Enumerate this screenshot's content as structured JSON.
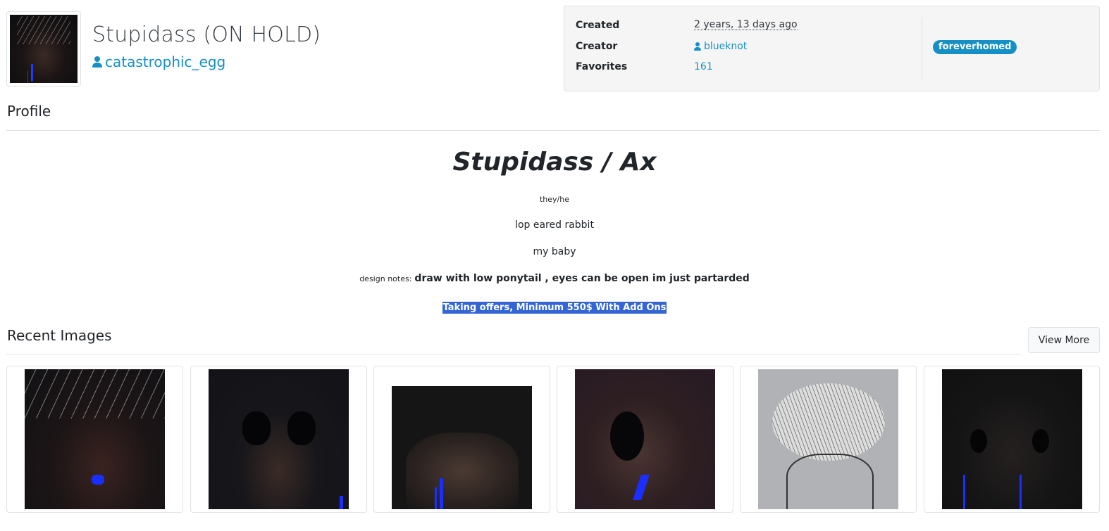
{
  "character": {
    "title": "Stupidass (ON HOLD)",
    "owner": "catastrophic_egg"
  },
  "info": {
    "created_label": "Created",
    "created_value": "2 years, 13 days ago",
    "creator_label": "Creator",
    "creator_value": "blueknot",
    "favorites_label": "Favorites",
    "favorites_value": "161",
    "tag": "foreverhomed"
  },
  "sections": {
    "profile": "Profile",
    "recent_images": "Recent Images",
    "view_more": "View More"
  },
  "profile": {
    "name": "Stupidass / Ax",
    "pronouns": "they/he",
    "species": "lop eared rabbit",
    "note": "my baby",
    "design_notes_label": "design notes:",
    "design_notes": "draw with low ponytail , eyes can be open im just partarded",
    "offer": "Taking offers, Minimum 550$ With Add Ons"
  },
  "colors": {
    "link": "#1590c4",
    "badge": "#1590c4",
    "highlight": "#3465d4",
    "accent_blue_art": "#1a2fff"
  },
  "icons": {
    "owner": "user-icon",
    "creator": "user-icon"
  }
}
